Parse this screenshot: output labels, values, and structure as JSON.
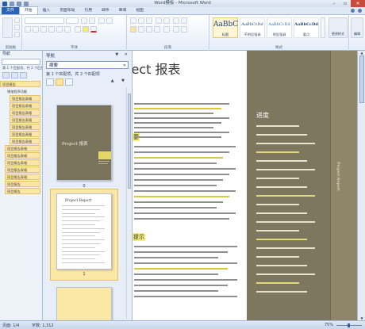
{
  "app_title": "Word模板 - Microsoft Word",
  "window_controls": {
    "minimize": "–",
    "maximize": "▫",
    "close": "✕"
  },
  "ribbon_tabs": {
    "file": "文件",
    "items": [
      "开始",
      "插入",
      "页面布局",
      "引用",
      "邮件",
      "审阅",
      "视图"
    ]
  },
  "ribbon": {
    "groups": [
      "剪贴板",
      "字体",
      "段落",
      "样式"
    ],
    "styles": [
      {
        "sample": "AaBbC",
        "name": "标题"
      },
      {
        "sample": "AaBbCcDd",
        "name": "不明显强调"
      },
      {
        "sample": "AaBbCcDd",
        "name": "明显强调"
      },
      {
        "sample": "AaBbCcDd",
        "name": "要点"
      }
    ],
    "change_styles": "更改样式",
    "edit": "编辑"
  },
  "nav_left": {
    "title": "导航",
    "match": "第 1 个匹配项，共 2 个匹配项",
    "headings": [
      {
        "label": "项目报告",
        "level": 0,
        "highlight": true
      },
      {
        "label": "增加程序功能",
        "level": 1,
        "highlight": false
      },
      {
        "label": "项目报告表格",
        "level": 2,
        "highlight": true
      },
      {
        "label": "项目报告表格",
        "level": 2,
        "highlight": true
      },
      {
        "label": "项目报告表格",
        "level": 2,
        "highlight": true
      },
      {
        "label": "项目报告表格",
        "level": 2,
        "highlight": true
      },
      {
        "label": "项目报告表格",
        "level": 2,
        "highlight": true
      },
      {
        "label": "项目报告表格",
        "level": 2,
        "highlight": true
      },
      {
        "label": "项目报告表格",
        "level": 2,
        "highlight": true
      },
      {
        "label": "项目报告表格",
        "level": 1,
        "highlight": true
      },
      {
        "label": "项目报告表格",
        "level": 1,
        "highlight": true
      },
      {
        "label": "项目报告表格",
        "level": 1,
        "highlight": true
      },
      {
        "label": "项目报告表格",
        "level": 1,
        "highlight": true
      },
      {
        "label": "项目报告表格",
        "level": 1,
        "highlight": true
      },
      {
        "label": "项目报告",
        "level": 1,
        "highlight": true
      },
      {
        "label": "项目报告",
        "level": 1,
        "highlight": true
      }
    ]
  },
  "nav_main": {
    "title": "导航",
    "controls": "▼ ✕",
    "search_value": "摘要",
    "clear_icon": "✕",
    "match": "第 1 个匹配项，共 2 个匹配项",
    "scroll_arrows": "▲ ▼",
    "pages": [
      {
        "number": "0",
        "cover_title": "Project 报表"
      },
      {
        "number": "1",
        "page_heading": "Project Report"
      }
    ]
  },
  "document": {
    "title": "ject 报表",
    "heading_1": "要",
    "heading_2": "提示",
    "sidebar_heading": "进度",
    "sidebar_vertical_text": "Project Report"
  },
  "status": {
    "page": "页面: 1/4",
    "words": "字数: 1,312",
    "zoom": "75%"
  },
  "colors": {
    "sidebar": "#7e775f",
    "highlight": "#f5f07a",
    "file_tab": "#2a63b6"
  }
}
